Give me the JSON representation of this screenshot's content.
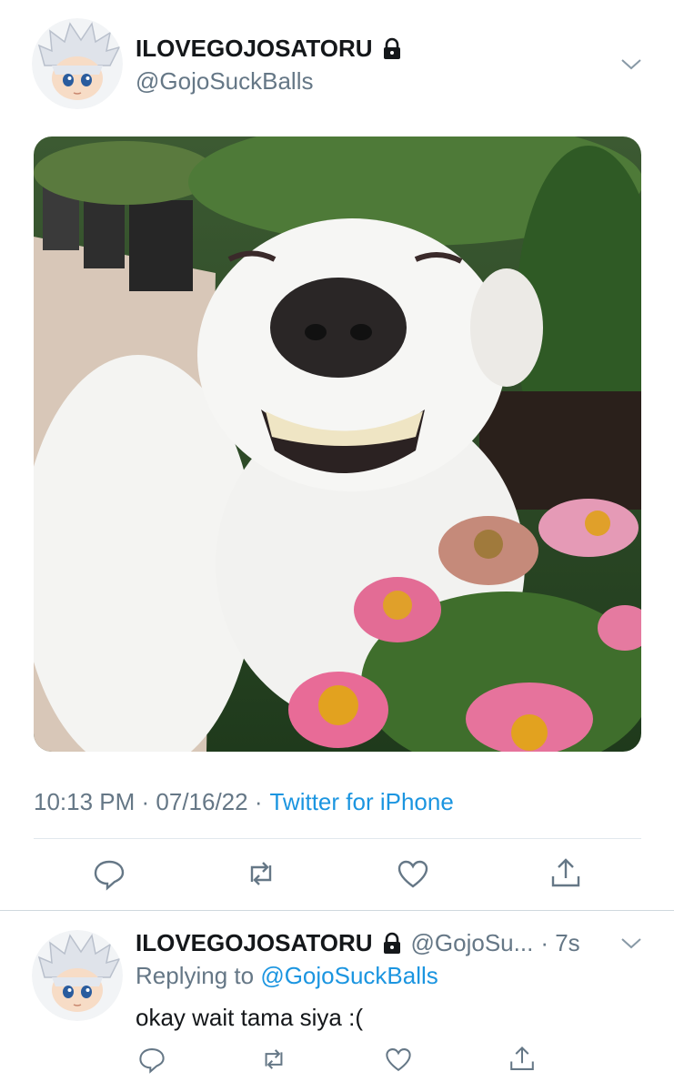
{
  "tweet": {
    "name": "ILOVEGOJOSATORU",
    "handle": "@GojoSuckBalls",
    "timestamp": "10:13 PM · 07/16/22 ·",
    "source": "Twitter for iPhone",
    "media_description": "smiling white dog with pink flowers",
    "verified_icon": "lock-icon"
  },
  "actions": {
    "reply": "reply-icon",
    "retweet": "retweet-icon",
    "like": "heart-icon",
    "share": "share-icon"
  },
  "reply": {
    "name": "ILOVEGOJOSATORU",
    "handle": "@GojoSu...",
    "time": "· 7s",
    "replying_prefix": "Replying to",
    "replying_to": "@GojoSuckBalls",
    "text": "okay wait tama siya :("
  },
  "colors": {
    "link": "#1b95e0",
    "secondary": "#657786",
    "divider": "#e1e8ed"
  }
}
